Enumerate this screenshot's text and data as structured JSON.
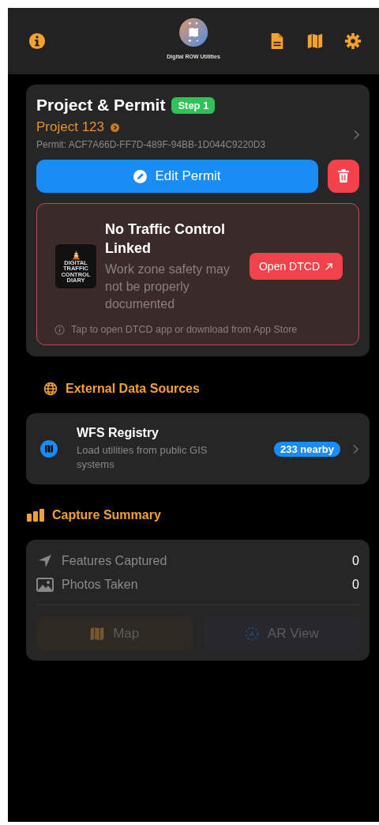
{
  "header": {
    "app_name": "Digital ROW Utilities"
  },
  "project_card": {
    "title": "Project & Permit",
    "step_badge": "Step 1",
    "project_name": "Project 123",
    "permit": "Permit: ACF7A66D-FF7D-489F-94BB-1D044C9220D3",
    "edit_button": "Edit Permit",
    "traffic_alert": {
      "title": "No Traffic Control Linked",
      "message": "Work zone safety may not be properly documented",
      "button": "Open DTCD",
      "logo_lines": [
        "DIGITAL",
        "TRAFFIC",
        "CONTROL",
        "DIARY"
      ],
      "hint": "Tap to open DTCD app or download from App Store"
    }
  },
  "external_section": {
    "title": "External Data Sources",
    "sources": [
      {
        "title": "WFS Registry",
        "subtitle": "Load utilities from public GIS systems",
        "badge": "233 nearby"
      }
    ]
  },
  "capture_section": {
    "title": "Capture Summary",
    "stats": [
      {
        "kind": "features",
        "label": "Features Captured",
        "value": "0"
      },
      {
        "kind": "photos",
        "label": "Photos Taken",
        "value": "0"
      }
    ],
    "actions": [
      {
        "kind": "map",
        "label": "Map",
        "disabled": true
      },
      {
        "kind": "ar",
        "label": "AR View",
        "disabled": true
      }
    ]
  }
}
